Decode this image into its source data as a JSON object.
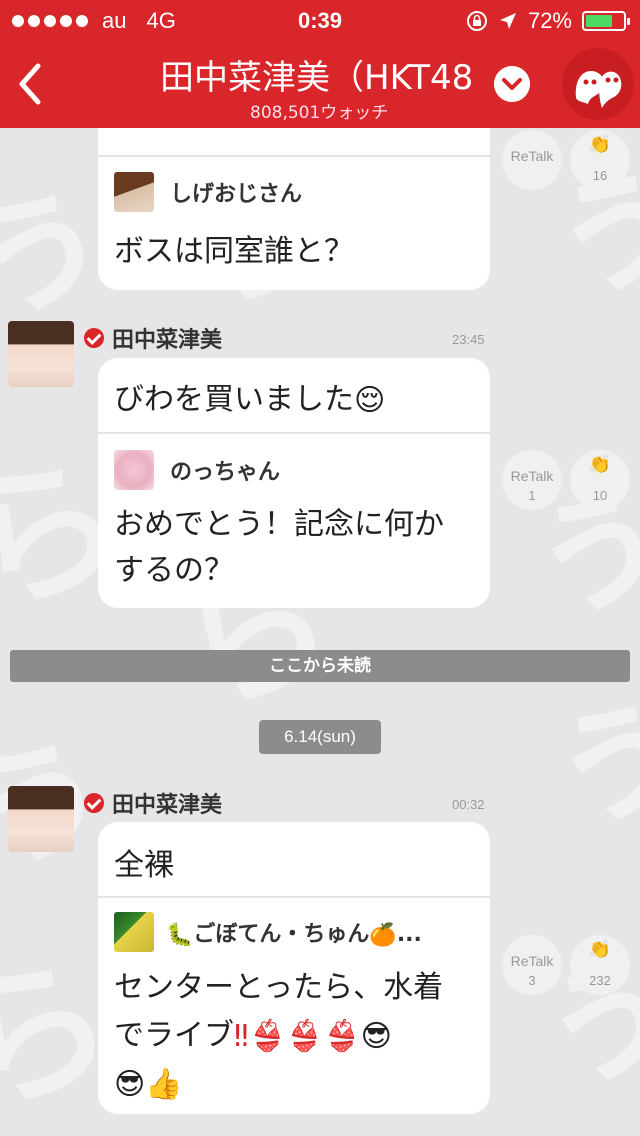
{
  "status_bar": {
    "carrier": "au",
    "network": "4G",
    "time": "0:39",
    "battery": "72%",
    "battery_level": 0.72
  },
  "header": {
    "title": "田中菜津美（HKT48",
    "watch_count": "808,501ウォッチ"
  },
  "top_message": {
    "reply_user": "しげおじさん",
    "reply_text": "ボスは同室誰と？",
    "retalk_label": "ReTalk",
    "clap_count": "16"
  },
  "message_1": {
    "poster": "田中菜津美",
    "time": "23:45",
    "text": "びわを買いました",
    "reply_user": "のっちゃん",
    "reply_text_line1": "おめでとう！記念に何か",
    "reply_text_line2": "するの？",
    "retalk_label": "ReTalk",
    "retalk_count": "1",
    "clap_count": "10"
  },
  "unread_divider": "ここから未読",
  "date_label": "6.14(sun)",
  "message_2": {
    "poster": "田中菜津美",
    "time": "00:32",
    "text": "全裸",
    "reply_user": "ごぼてん・ちゅん",
    "reply_user_suffix": "...",
    "reply_text_line1": "センターとったら、水着",
    "reply_text_line2": "でライブ",
    "retalk_label": "ReTalk",
    "retalk_count": "3",
    "clap_count": "232"
  },
  "colors": {
    "brand_red": "#d8262a",
    "background": "#e6e6e6",
    "divider_gray": "#8c8c8c"
  }
}
